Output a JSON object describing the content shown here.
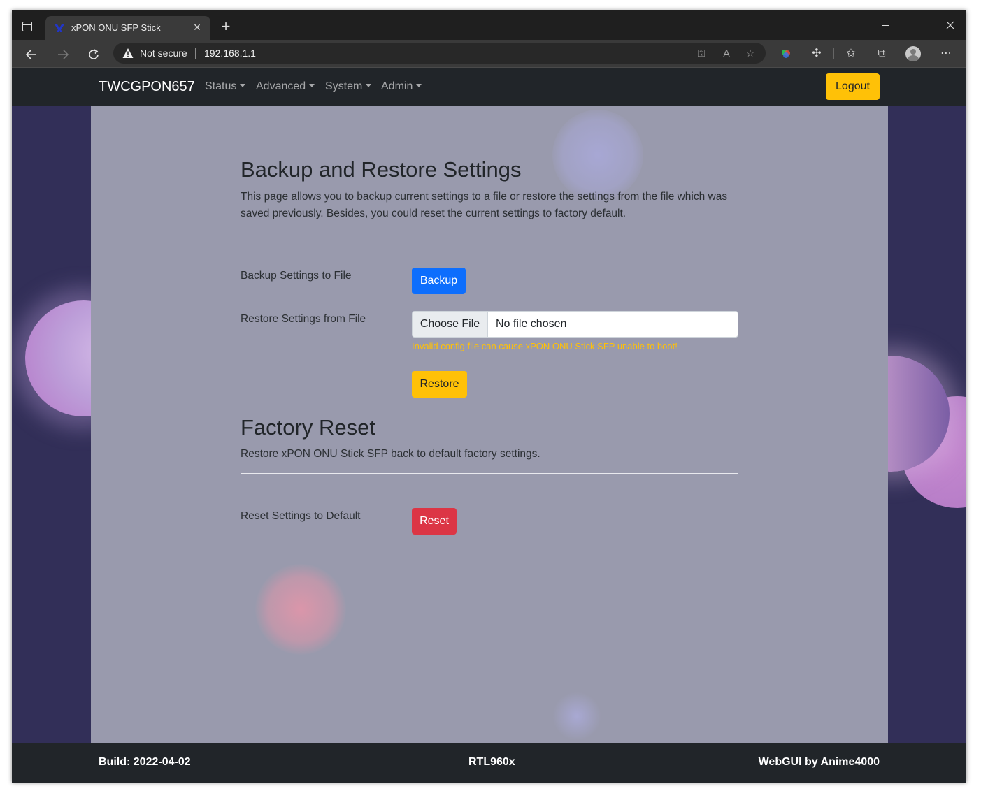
{
  "browser": {
    "tab_title": "xPON ONU SFP Stick",
    "security_label": "Not secure",
    "url": "192.168.1.1",
    "new_tab_label": "+",
    "close_tab_label": "×"
  },
  "navbar": {
    "brand": "TWCGPON657",
    "menus": [
      "Status",
      "Advanced",
      "System",
      "Admin"
    ],
    "logout_label": "Logout"
  },
  "backup_section": {
    "title": "Backup and Restore Settings",
    "description": "This page allows you to backup current settings to a file or restore the settings from the file which was saved previously. Besides, you could reset the current settings to factory default.",
    "backup_label": "Backup Settings to File",
    "backup_button": "Backup",
    "restore_label": "Restore Settings from File",
    "file_button": "Choose File",
    "file_status": "No file chosen",
    "warning": "Invalid config file can cause xPON ONU Stick SFP unable to boot!",
    "restore_button": "Restore"
  },
  "reset_section": {
    "title": "Factory Reset",
    "description": "Restore xPON ONU Stick SFP back to default factory settings.",
    "reset_label": "Reset Settings to Default",
    "reset_button": "Reset"
  },
  "footer": {
    "build": "Build: 2022-04-02",
    "chip": "RTL960x",
    "credit": "WebGUI by Anime4000"
  },
  "colors": {
    "navbar": "#212529",
    "page_background": "#322f58",
    "panel": "#999aad",
    "primary": "#0d6efd",
    "warning": "#ffc107",
    "danger": "#dc3545"
  }
}
